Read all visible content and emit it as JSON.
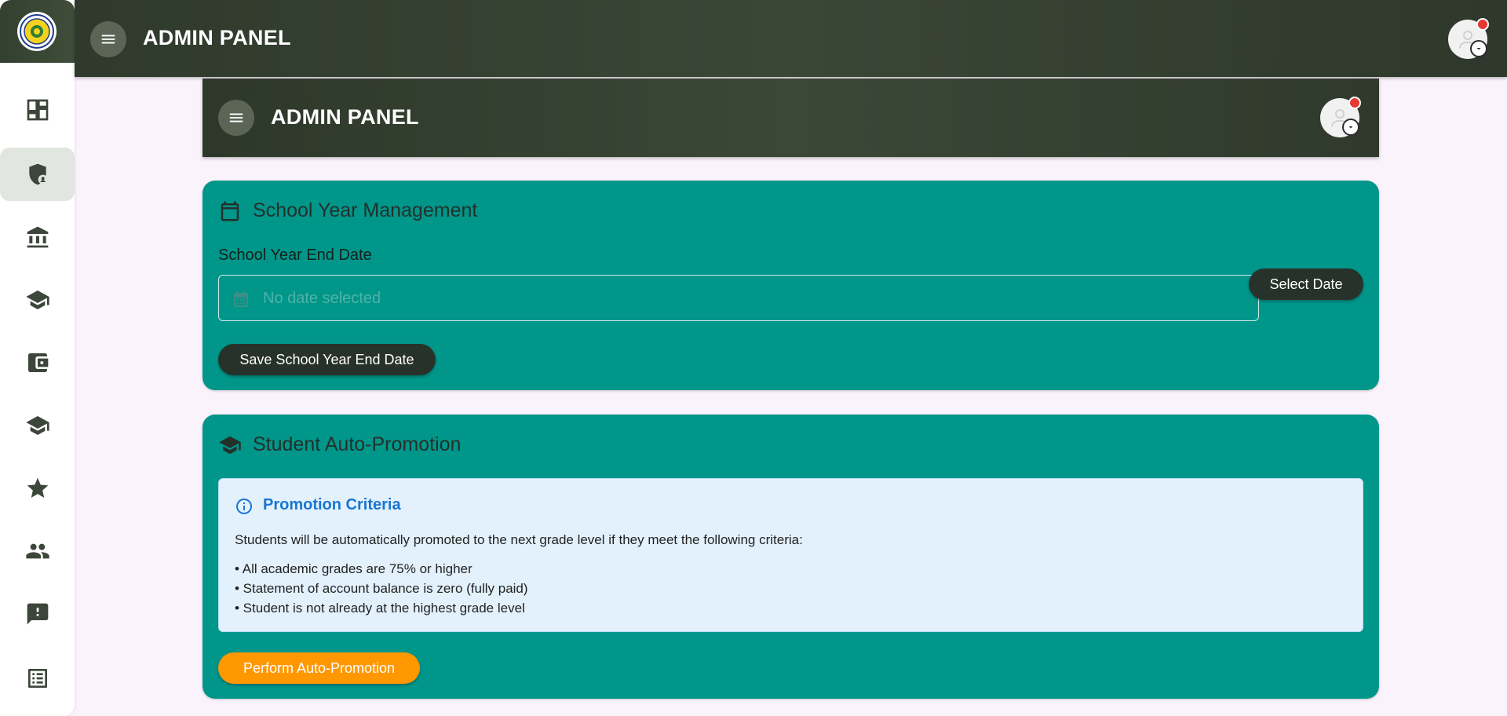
{
  "app": {
    "title": "ADMIN PANEL"
  },
  "sidebar": {
    "items": [
      {
        "name": "dashboard-icon"
      },
      {
        "name": "admin-shield-icon",
        "active": true
      },
      {
        "name": "institution-icon"
      },
      {
        "name": "school-cap-icon"
      },
      {
        "name": "wallet-icon"
      },
      {
        "name": "school-cap-icon"
      },
      {
        "name": "star-icon"
      },
      {
        "name": "people-icon"
      },
      {
        "name": "feedback-icon"
      },
      {
        "name": "list-icon"
      }
    ]
  },
  "inner_header": {
    "title": "ADMIN PANEL"
  },
  "school_year": {
    "title": "School Year Management",
    "field_label": "School Year End Date",
    "date_placeholder": "No date selected",
    "select_button": "Select Date",
    "save_button": "Save School Year End Date"
  },
  "promotion": {
    "title": "Student Auto-Promotion",
    "criteria_title": "Promotion Criteria",
    "criteria_description": "Students will be automatically promoted to the next grade level if they meet the following criteria:",
    "criteria": [
      "• All academic grades are 75% or higher",
      "• Statement of account balance is zero (fully paid)",
      "• Student is not already at the highest grade level"
    ],
    "button": "Perform Auto-Promotion"
  },
  "colors": {
    "header": "#344031",
    "card": "#00968a",
    "primary_button": "#27322a",
    "accent_button": "#ff9800",
    "info_blue": "#1976d2",
    "notification": "#e53935"
  }
}
